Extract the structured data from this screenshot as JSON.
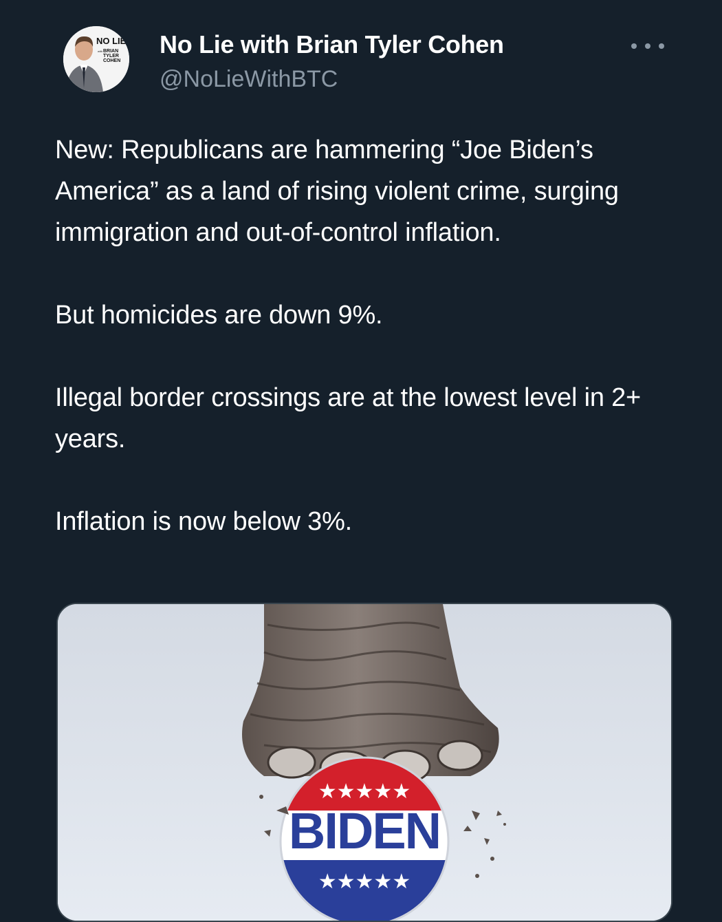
{
  "author": {
    "display_name": "No Lie with Brian Tyler Cohen",
    "handle": "@NoLieWithBTC",
    "avatar": {
      "logo_text": "NO LIE",
      "logo_sub": [
        "with",
        "BRIAN",
        "TYLER",
        "COHEN"
      ]
    }
  },
  "tweet": {
    "paragraphs": [
      "New: Republicans are hammering “Joe Biden’s America” as a land of rising violent crime, surging immigration and out-of-control inflation.",
      "But homicides are down 9%.",
      "Illegal border crossings are at the lowest level in 2+ years.",
      "Inflation is now below 3%."
    ]
  },
  "media": {
    "button_text": "BIDEN",
    "stars_top": "★★★★★",
    "stars_bottom": "★★★★★"
  },
  "icons": {
    "more": "more-horizontal-icon"
  },
  "colors": {
    "background": "#15202b",
    "text_primary": "#ffffff",
    "text_secondary": "#8b98a5",
    "button_red": "#d3202b",
    "button_blue": "#2a3f9a"
  }
}
